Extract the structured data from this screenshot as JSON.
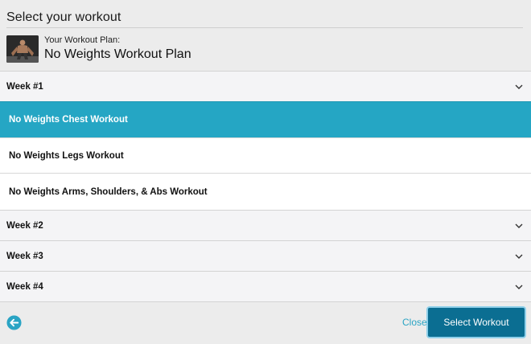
{
  "dialog": {
    "title": "Select your workout"
  },
  "plan": {
    "label": "Your Workout Plan:",
    "name": "No Weights Workout Plan",
    "thumbnail_icon": "athlete-photo"
  },
  "weeks": [
    {
      "label": "Week #1",
      "expanded": true,
      "workouts": [
        {
          "label": "No Weights Chest Workout",
          "selected": true
        },
        {
          "label": "No Weights Legs Workout",
          "selected": false
        },
        {
          "label": "No Weights Arms, Shoulders, & Abs Workout",
          "selected": false
        }
      ]
    },
    {
      "label": "Week #2",
      "expanded": false
    },
    {
      "label": "Week #3",
      "expanded": false
    },
    {
      "label": "Week #4",
      "expanded": false
    }
  ],
  "footer": {
    "back_icon": "back-arrow-circle-icon",
    "close_label": "Close",
    "select_label": "Select Workout"
  },
  "colors": {
    "selected_row": "#25a6c4",
    "primary_button": "#0b6e92",
    "link": "#2aa4c4"
  }
}
